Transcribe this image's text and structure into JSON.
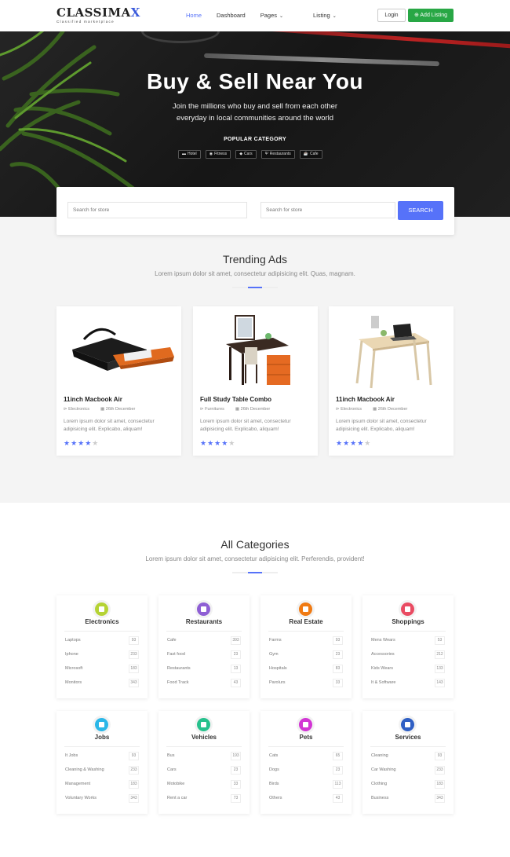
{
  "nav": {
    "logo_main": "CLASSIMA",
    "logo_accent": "X",
    "logo_sub": "Classified marketplace",
    "menu": [
      {
        "label": "Home",
        "active": true
      },
      {
        "label": "Dashboard"
      },
      {
        "label": "Pages",
        "dropdown": true
      },
      {
        "label": "Listing",
        "dropdown": true
      }
    ],
    "login_label": "Login",
    "add_listing_label": "Add Listing"
  },
  "hero": {
    "title": "Buy & Sell Near You",
    "subtitle": "Join the millions who buy and sell from each other everyday in local communities around the world",
    "popular_label": "POPULAR CATEGORY",
    "tags": [
      {
        "icon": "bed-icon",
        "label": "Hotel"
      },
      {
        "icon": "fitness-icon",
        "label": "Fitness"
      },
      {
        "icon": "car-icon",
        "label": "Cars"
      },
      {
        "icon": "restaurant-icon",
        "label": "Restaurants"
      },
      {
        "icon": "coffee-icon",
        "label": "Cafe"
      }
    ]
  },
  "search": {
    "placeholder_1": "Search for store",
    "placeholder_2": "Search for store",
    "button_label": "SEARCH"
  },
  "trending": {
    "title": "Trending Ads",
    "subtitle": "Lorem ipsum dolor sit amet, consectetur adipisicing elit. Quas, magnam.",
    "cards": [
      {
        "title": "11inch Macbook Air",
        "category": "Electronics",
        "date": "26th December",
        "desc": "Lorem ipsum dolor sit amet, consectetur adipisicing elit. Explicabo, aliquam!",
        "rating": 4
      },
      {
        "title": "Full Study Table Combo",
        "category": "Furnitures",
        "date": "26th December",
        "desc": "Lorem ipsum dolor sit amet, consectetur adipisicing elit. Explicabo, aliquam!",
        "rating": 4
      },
      {
        "title": "11inch Macbook Air",
        "category": "Electronics",
        "date": "26th December",
        "desc": "Lorem ipsum dolor sit amet, consectetur adipisicing elit. Explicabo, aliquam!",
        "rating": 4
      }
    ]
  },
  "categories": {
    "title": "All Categories",
    "subtitle": "Lorem ipsum dolor sit amet, consectetur adipisicing elit. Perferendis, provident!",
    "items": [
      {
        "name": "Electronics",
        "icon": "laptop-icon",
        "color": "#b5d334",
        "rows": [
          [
            "Laptops",
            "93"
          ],
          [
            "Iphone",
            "233"
          ],
          [
            "Microsoft",
            "183"
          ],
          [
            "Monitors",
            "343"
          ]
        ]
      },
      {
        "name": "Restaurants",
        "icon": "apple-icon",
        "color": "#8e5ed4",
        "rows": [
          [
            "Cafe",
            "393"
          ],
          [
            "Fast food",
            "23"
          ],
          [
            "Restaurants",
            "13"
          ],
          [
            "Food Track",
            "43"
          ]
        ]
      },
      {
        "name": "Real Estate",
        "icon": "home-icon",
        "color": "#f07a12",
        "rows": [
          [
            "Farms",
            "93"
          ],
          [
            "Gym",
            "23"
          ],
          [
            "Hospitals",
            "83"
          ],
          [
            "Parolurs",
            "33"
          ]
        ]
      },
      {
        "name": "Shoppings",
        "icon": "shopping-cart-icon",
        "color": "#e94b62",
        "rows": [
          [
            "Mens Wears",
            "53"
          ],
          [
            "Accessories",
            "212"
          ],
          [
            "Kids Wears",
            "133"
          ],
          [
            "It & Software",
            "143"
          ]
        ]
      },
      {
        "name": "Jobs",
        "icon": "briefcase-icon",
        "color": "#2bb7e8",
        "rows": [
          [
            "It Jobs",
            "93"
          ],
          [
            "Cleaning & Washing",
            "233"
          ],
          [
            "Management",
            "183"
          ],
          [
            "Voluntary Works",
            "343"
          ]
        ]
      },
      {
        "name": "Vehicles",
        "icon": "car-icon",
        "color": "#27c18d",
        "rows": [
          [
            "Bus",
            "193"
          ],
          [
            "Cars",
            "23"
          ],
          [
            "Motobike",
            "33"
          ],
          [
            "Rent a car",
            "73"
          ]
        ]
      },
      {
        "name": "Pets",
        "icon": "paw-icon",
        "color": "#d235d4",
        "rows": [
          [
            "Cats",
            "65"
          ],
          [
            "Dogs",
            "23"
          ],
          [
            "Birds",
            "113"
          ],
          [
            "Others",
            "43"
          ]
        ]
      },
      {
        "name": "Services",
        "icon": "users-icon",
        "color": "#2f5fc4",
        "rows": [
          [
            "Cleaning",
            "93"
          ],
          [
            "Car Washing",
            "233"
          ],
          [
            "Clothing",
            "183"
          ],
          [
            "Business",
            "343"
          ]
        ]
      }
    ]
  }
}
